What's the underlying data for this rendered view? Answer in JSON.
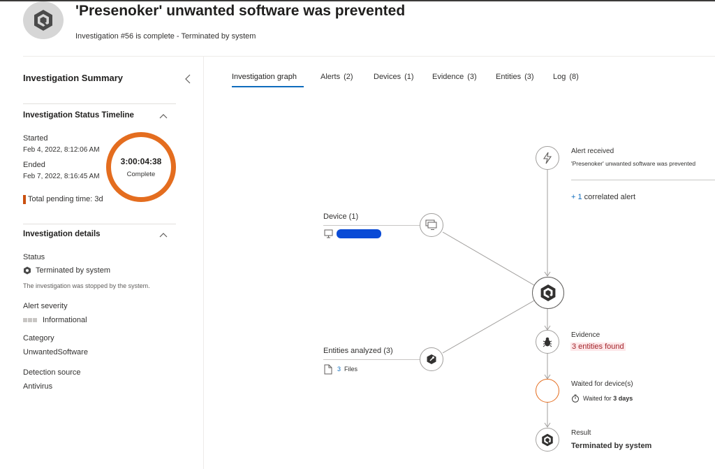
{
  "header": {
    "title": "'Presenoker' unwanted software was prevented",
    "subtitle": "Investigation #56 is complete - Terminated by system"
  },
  "summary": {
    "title": "Investigation Summary",
    "timeline": {
      "title": "Investigation Status Timeline",
      "started_label": "Started",
      "started_value": "Feb 4, 2022, 8:12:06 AM",
      "ended_label": "Ended",
      "ended_value": "Feb 7, 2022, 8:16:45 AM",
      "duration": "3:00:04:38",
      "status": "Complete",
      "pending": "Total pending time: 3d"
    },
    "details": {
      "title": "Investigation details",
      "status_label": "Status",
      "status_value": "Terminated by system",
      "status_desc": "The investigation was stopped by the system.",
      "severity_label": "Alert severity",
      "severity_value": "Informational",
      "category_label": "Category",
      "category_value": "UnwantedSoftware",
      "source_label": "Detection source",
      "source_value": "Antivirus"
    }
  },
  "tabs": [
    {
      "label": "Investigation graph",
      "count": ""
    },
    {
      "label": "Alerts",
      "count": "(2)"
    },
    {
      "label": "Devices",
      "count": "(1)"
    },
    {
      "label": "Evidence",
      "count": "(3)"
    },
    {
      "label": "Entities",
      "count": "(3)"
    },
    {
      "label": "Log",
      "count": "(8)"
    }
  ],
  "graph": {
    "alert_received_label": "Alert received",
    "alert_received_text": "'Presenoker' unwanted software was prevented",
    "correlated_prefix": "+ 1",
    "correlated_text": "correlated alert",
    "device_label": "Device (1)",
    "entities_label": "Entities analyzed (3)",
    "files_count": "3",
    "files_label": "Files",
    "evidence_label": "Evidence",
    "evidence_text": "3 entities found",
    "waited_label": "Waited for device(s)",
    "waited_prefix": "Waited for",
    "waited_value": "3 days",
    "result_label": "Result",
    "result_value": "Terminated by system"
  },
  "colors": {
    "accent": "#0f6cbd",
    "ring": "#e46d1f",
    "evidence_bg": "#fde7e9"
  }
}
